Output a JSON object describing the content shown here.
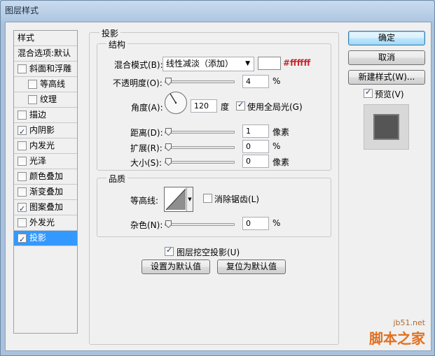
{
  "window": {
    "title": "图层样式"
  },
  "sidebar": {
    "header": "样式",
    "blend_options": "混合选项:默认",
    "items": [
      {
        "label": "斜面和浮雕",
        "checked": false
      },
      {
        "label": "等高线",
        "checked": false
      },
      {
        "label": "纹理",
        "checked": false
      },
      {
        "label": "描边",
        "checked": false
      },
      {
        "label": "内阴影",
        "checked": true
      },
      {
        "label": "内发光",
        "checked": false
      },
      {
        "label": "光泽",
        "checked": false
      },
      {
        "label": "颜色叠加",
        "checked": false
      },
      {
        "label": "渐变叠加",
        "checked": false
      },
      {
        "label": "图案叠加",
        "checked": true
      },
      {
        "label": "外发光",
        "checked": false
      },
      {
        "label": "投影",
        "checked": true
      }
    ]
  },
  "panel": {
    "title": "投影",
    "structure": {
      "title": "结构",
      "blend_mode_label": "混合模式(B):",
      "blend_mode_value": "线性减淡（添加）",
      "color_text": "#ffffff",
      "opacity_label": "不透明度(O):",
      "opacity_value": "4",
      "opacity_unit": "%",
      "angle_label": "角度(A):",
      "angle_value": "120",
      "angle_unit": "度",
      "global_light_label": "使用全局光(G)",
      "global_light_checked": true,
      "distance_label": "距离(D):",
      "distance_value": "1",
      "distance_unit": "像素",
      "spread_label": "扩展(R):",
      "spread_value": "0",
      "spread_unit": "%",
      "size_label": "大小(S):",
      "size_value": "0",
      "size_unit": "像素"
    },
    "quality": {
      "title": "品质",
      "contour_label": "等高线:",
      "antialias_label": "消除锯齿(L)",
      "antialias_checked": false,
      "noise_label": "杂色(N):",
      "noise_value": "0",
      "noise_unit": "%"
    },
    "knockout_label": "图层挖空投影(U)",
    "knockout_checked": true,
    "make_default": "设置为默认值",
    "reset_default": "复位为默认值"
  },
  "buttons": {
    "ok": "确定",
    "cancel": "取消",
    "new_style": "新建样式(W)...",
    "preview_label": "预览(V)",
    "preview_checked": true
  },
  "watermark": {
    "site": "jb51.net",
    "brand": "脚本之家"
  }
}
